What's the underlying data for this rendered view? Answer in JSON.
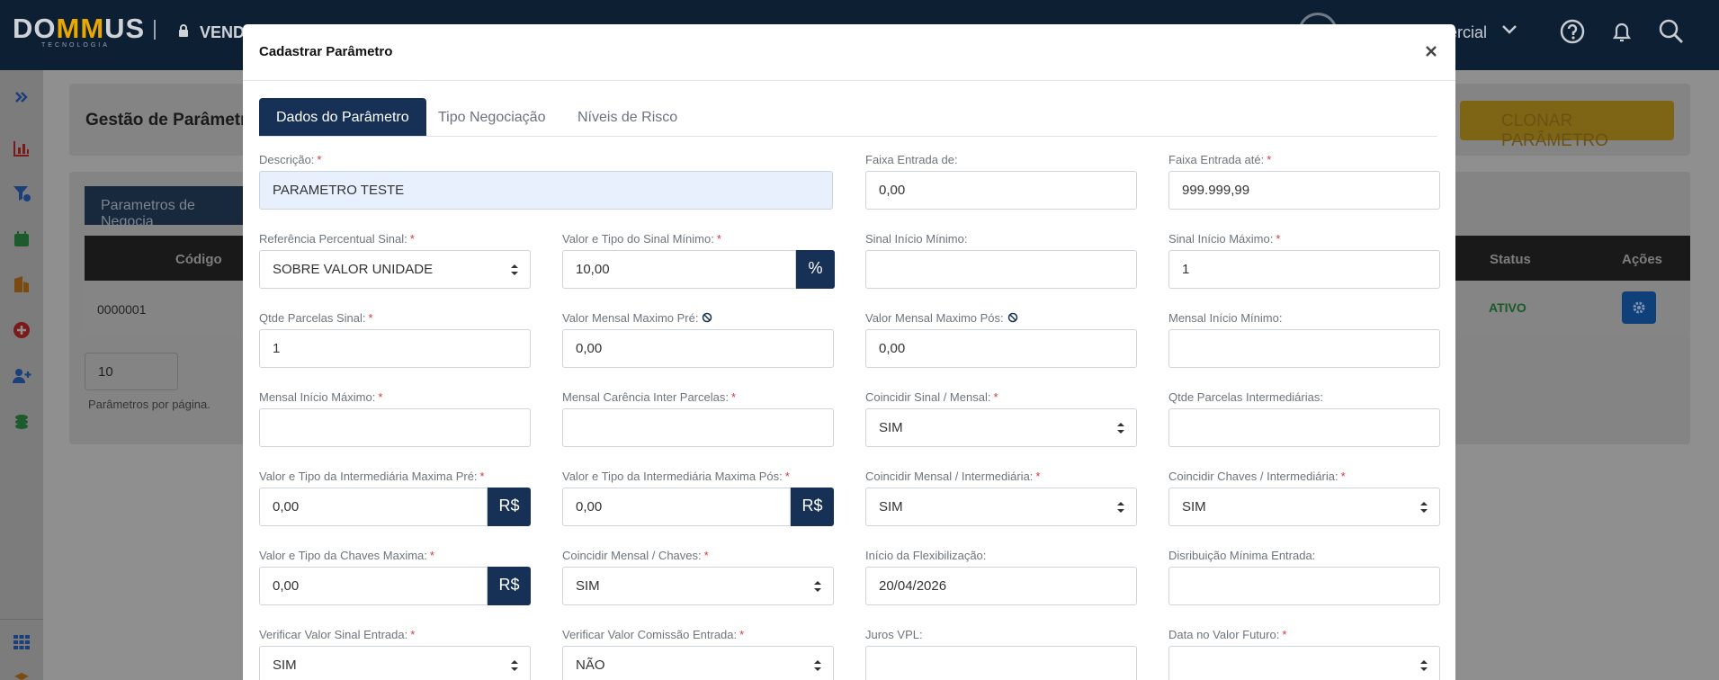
{
  "colors": {
    "navy": "#163056",
    "topbar": "#0d1f33",
    "required": "#dc3545",
    "accent": "#e8a800"
  },
  "topbar": {
    "logo_a": "DO",
    "logo_mm": "MM",
    "logo_b": "US",
    "logo_sub": "TECNOLOGIA",
    "module": "VEND",
    "user_role": "ercial",
    "icons": [
      "lock-icon",
      "chevron-down-icon",
      "help-icon",
      "bell-icon",
      "search-icon"
    ]
  },
  "sidebar": {
    "icons": [
      "double-chevron-right-icon",
      "chart-bar-icon",
      "funnel-money-icon",
      "calendar-icon",
      "building-icon",
      "plus-circle-icon",
      "user-plus-icon",
      "coins-icon",
      "grid-icon",
      "box-icon"
    ]
  },
  "background": {
    "page_title": "Gestão de Parâmetro",
    "clone_label": "CLONAR PARÂMETRO",
    "tab_label": "Parametros de Negocia",
    "columns": {
      "codigo": "Código",
      "status": "Status",
      "acoes": "Ações"
    },
    "row": {
      "codigo": "0000001",
      "status": "ATIVO"
    },
    "per_page_value": "10",
    "per_page_label": "Parâmetros por página."
  },
  "modal": {
    "title": "Cadastrar Parâmetro",
    "tabs": [
      "Dados do Parâmetro",
      "Tipo Negociação",
      "Níveis de Risco"
    ],
    "fields": [
      {
        "label": "Descrição:",
        "value": "PARAMETRO TESTE"
      },
      {
        "label": "Faixa Entrada de:",
        "value": "0,00"
      },
      {
        "label": "Faixa Entrada até:",
        "value": "999.999,99"
      },
      {
        "label": "Referência Percentual Sinal:",
        "value": "SOBRE VALOR UNIDADE"
      },
      {
        "label": "Valor e Tipo do Sinal Mínimo:",
        "value": "10,00",
        "addon": "%"
      },
      {
        "label": "Sinal Início Mínimo:",
        "value": ""
      },
      {
        "label": "Sinal Início Máximo:",
        "value": "1"
      },
      {
        "label": "Qtde Parcelas Sinal:",
        "value": "1"
      },
      {
        "label": "Valor Mensal Maximo Pré:",
        "value": "0,00"
      },
      {
        "label": "Valor Mensal Maximo Pós:",
        "value": "0,00"
      },
      {
        "label": "Mensal Início Mínimo:",
        "value": ""
      },
      {
        "label": "Mensal Início Máximo:",
        "value": ""
      },
      {
        "label": "Mensal Carência Inter Parcelas:",
        "value": ""
      },
      {
        "label": "Coincidir Sinal / Mensal:",
        "value": "SIM"
      },
      {
        "label": "Qtde Parcelas Intermediárias:",
        "value": ""
      },
      {
        "label": "Valor e Tipo da Intermediária Maxima Pré:",
        "value": "0,00",
        "addon": "R$"
      },
      {
        "label": "Valor e Tipo da Intermediária Maxima Pós:",
        "value": "0,00",
        "addon": "R$"
      },
      {
        "label": "Coincidir Mensal / Intermediária:",
        "value": "SIM"
      },
      {
        "label": "Coincidir Chaves / Intermediária:",
        "value": "SIM"
      },
      {
        "label": "Valor e Tipo da Chaves Maxima:",
        "value": "0,00",
        "addon": "R$"
      },
      {
        "label": "Coincidir Mensal / Chaves:",
        "value": "SIM"
      },
      {
        "label": "Início da Flexibilização:",
        "value": "20/04/2026"
      },
      {
        "label": "Disribuição Mínima Entrada:",
        "value": ""
      },
      {
        "label": "Verificar Valor Sinal Entrada:",
        "value": "SIM"
      },
      {
        "label": "Verificar Valor Comissão Entrada:",
        "value": "NÃO"
      },
      {
        "label": "Juros VPL:",
        "value": ""
      },
      {
        "label": "Data no Valor Futuro:",
        "value": ""
      }
    ]
  }
}
